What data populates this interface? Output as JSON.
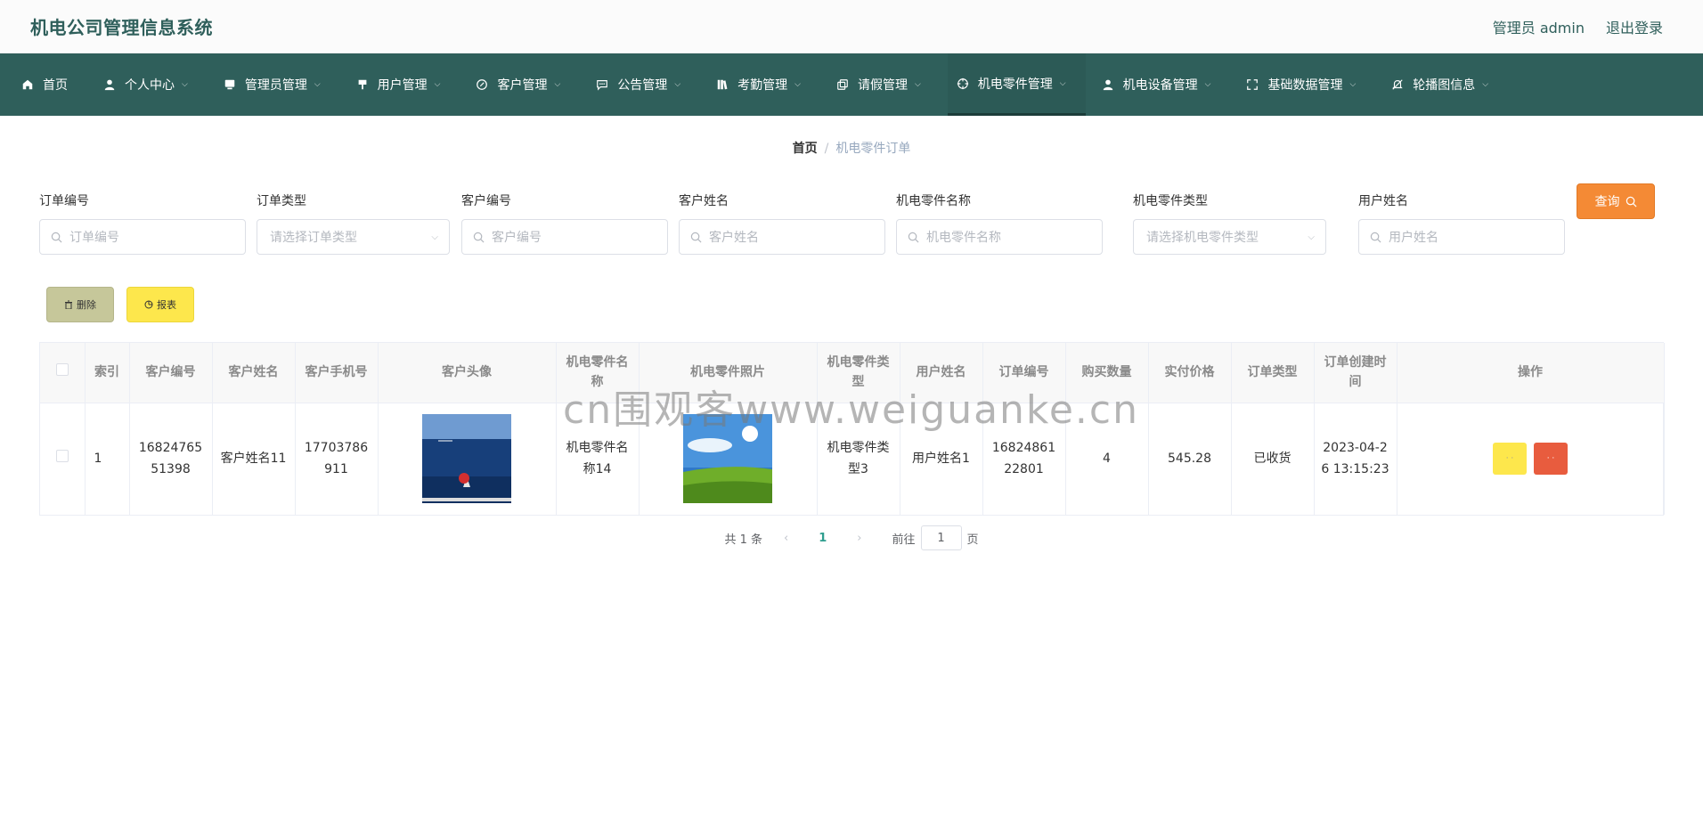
{
  "header": {
    "title": "机电公司管理信息系统",
    "user": "管理员 admin",
    "logout": "退出登录"
  },
  "nav": [
    {
      "label": "首页",
      "icon": "home-icon",
      "caret": false
    },
    {
      "label": "个人中心",
      "icon": "user-icon",
      "caret": true
    },
    {
      "label": "管理员管理",
      "icon": "monitor-icon",
      "caret": true
    },
    {
      "label": "用户管理",
      "icon": "brush-icon",
      "caret": true
    },
    {
      "label": "客户管理",
      "icon": "compass-icon",
      "caret": true
    },
    {
      "label": "公告管理",
      "icon": "chat-icon",
      "caret": true
    },
    {
      "label": "考勤管理",
      "icon": "book-icon",
      "caret": true
    },
    {
      "label": "请假管理",
      "icon": "copy-icon",
      "caret": true
    },
    {
      "label": "机电零件管理",
      "icon": "aim-icon",
      "caret": true,
      "active": true
    },
    {
      "label": "机电设备管理",
      "icon": "user-icon",
      "caret": true
    },
    {
      "label": "基础数据管理",
      "icon": "fullscreen-icon",
      "caret": true
    },
    {
      "label": "轮播图信息",
      "icon": "bell-off-icon",
      "caret": true
    }
  ],
  "breadcrumb": {
    "home": "首页",
    "separator": "/",
    "current": "机电零件订单"
  },
  "filters": {
    "order_no": {
      "label": "订单编号",
      "placeholder": "订单编号"
    },
    "order_type": {
      "label": "订单类型",
      "placeholder": "请选择订单类型"
    },
    "customer_no": {
      "label": "客户编号",
      "placeholder": "客户编号"
    },
    "customer_name": {
      "label": "客户姓名",
      "placeholder": "客户姓名"
    },
    "part_name": {
      "label": "机电零件名称",
      "placeholder": "机电零件名称"
    },
    "part_type": {
      "label": "机电零件类型",
      "placeholder": "请选择机电零件类型"
    },
    "user_name": {
      "label": "用户姓名",
      "placeholder": "用户姓名"
    },
    "query_label": "查询"
  },
  "actions": {
    "delete_label": "删除",
    "report_label": "报表"
  },
  "table": {
    "headers": [
      "索引",
      "客户编号",
      "客户姓名",
      "客户手机号",
      "客户头像",
      "机电零件名称",
      "机电零件照片",
      "机电零件类型",
      "用户姓名",
      "订单编号",
      "购买数量",
      "实付价格",
      "订单类型",
      "订单创建时间",
      "操作"
    ],
    "rows": [
      {
        "index": "1",
        "customer_no": "1682476551398",
        "customer_name": "客户姓名11",
        "phone": "17703786911",
        "part_name": "机电零件名称14",
        "part_type": "机电零件类型3",
        "user_name": "用户姓名1",
        "order_no": "1682486122801",
        "quantity": "4",
        "price": "545.28",
        "order_type": "已收货",
        "created": "2023-04-26 13:15:23",
        "op_edit": "· ·",
        "op_delete": "· ·"
      }
    ]
  },
  "pagination": {
    "total": "共 1 条",
    "prev": "‹",
    "page": "1",
    "next": "›",
    "goto": "前往",
    "goto_value": "1",
    "page_suffix": "页"
  },
  "watermark": "cn围观客www.weiguanke.cn",
  "colors": {
    "nav_bg": "#2f5f5b",
    "query": "#f48a35",
    "delete": "#c6c79a",
    "report": "#fde74c",
    "danger": "#e85c3e"
  }
}
